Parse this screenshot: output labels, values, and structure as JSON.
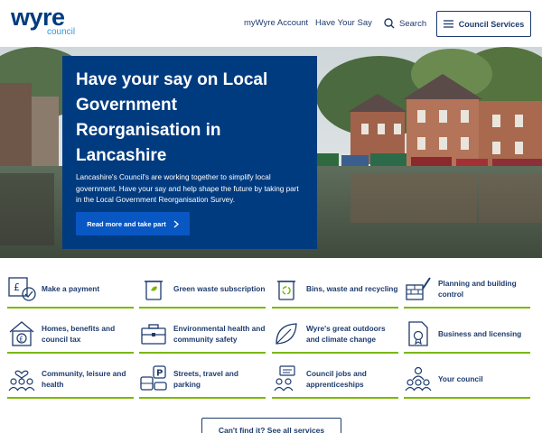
{
  "header": {
    "logo_main": "wyre",
    "logo_sub": "council",
    "nav": [
      "myWyre Account",
      "Have Your Say"
    ],
    "search_label": "Search",
    "council_services_label": "Council Services"
  },
  "hero": {
    "title": "Have your say on Local Government Reorganisation in Lancashire",
    "text": "Lancashire's Council's are working together to simplify local government. Have your say and help shape the future by taking part in the Local Government Reorganisation Survey.",
    "button_label": "Read more and take part"
  },
  "services": [
    {
      "label": "Make a payment",
      "icon": "payment-icon"
    },
    {
      "label": "Green waste subscription",
      "icon": "green-bin-icon"
    },
    {
      "label": "Bins, waste and recycling",
      "icon": "recycling-bin-icon"
    },
    {
      "label": "Planning and building control",
      "icon": "bricks-pencil-icon"
    },
    {
      "label": "Homes, benefits and council tax",
      "icon": "house-pound-icon"
    },
    {
      "label": "Environmental health and community safety",
      "icon": "briefcase-icon"
    },
    {
      "label": "Wyre's great outdoors and climate change",
      "icon": "leaf-icon"
    },
    {
      "label": "Business and licensing",
      "icon": "certificate-icon"
    },
    {
      "label": "Community, leisure and health",
      "icon": "community-heart-icon"
    },
    {
      "label": "Streets, travel and parking",
      "icon": "parking-bus-icon"
    },
    {
      "label": "Council jobs and apprenticeships",
      "icon": "jobs-people-icon"
    },
    {
      "label": "Your council",
      "icon": "council-people-icon"
    }
  ],
  "see_all_label": "Can't find it? See all services",
  "colors": {
    "brand_blue": "#003b80",
    "accent_green": "#7ab800",
    "button_blue": "#0857c3"
  }
}
